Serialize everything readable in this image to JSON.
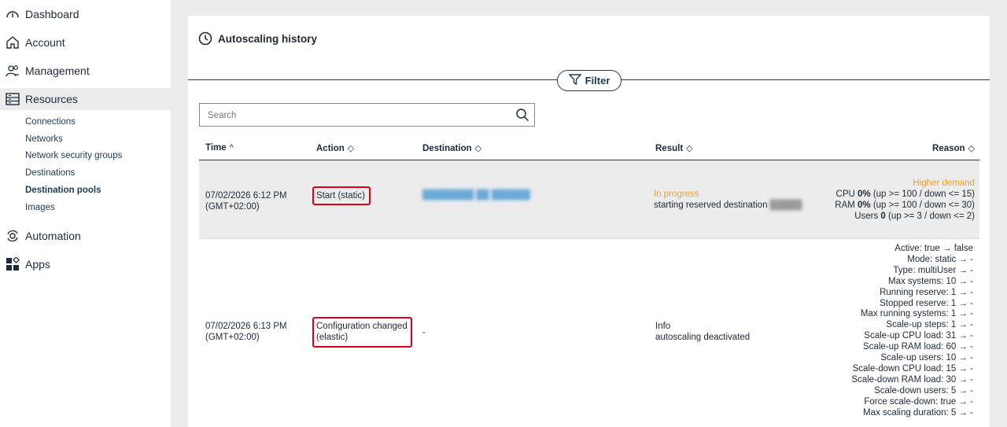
{
  "sidebar": {
    "items": [
      {
        "label": "Dashboard",
        "icon": "gauge-icon"
      },
      {
        "label": "Account",
        "icon": "home-icon"
      },
      {
        "label": "Management",
        "icon": "users-icon"
      },
      {
        "label": "Resources",
        "icon": "server-icon"
      },
      {
        "label": "Automation",
        "icon": "gear-sync-icon"
      },
      {
        "label": "Apps",
        "icon": "apps-icon"
      }
    ],
    "sub_items": [
      "Connections",
      "Networks",
      "Network security groups",
      "Destinations",
      "Destination pools",
      "Images"
    ]
  },
  "panel": {
    "title": "Autoscaling history",
    "filter_label": "Filter",
    "search_placeholder": "Search"
  },
  "table": {
    "columns": [
      "Time",
      "Action",
      "Destination",
      "Result",
      "Reason"
    ],
    "rows": [
      {
        "time_line1": "07/02/2026 6:12 PM",
        "time_line2": "(GMT+02:00)",
        "action": "Start (static)",
        "destination": "",
        "result_status": "In progress",
        "result_detail": "starting reserved destination",
        "reason_title": "Higher demand",
        "reason_cpu_prefix": "CPU ",
        "reason_cpu_value": "0%",
        "reason_cpu_suffix": " (up >= 100 / down <= 15)",
        "reason_ram_prefix": "RAM ",
        "reason_ram_value": "0%",
        "reason_ram_suffix": " (up >= 100 / down <= 30)",
        "reason_users_prefix": "Users ",
        "reason_users_value": "0",
        "reason_users_suffix": " (up >= 3 / down <= 2)"
      },
      {
        "time_line1": "07/02/2026 6:13 PM",
        "time_line2": "(GMT+02:00)",
        "action_line1": "Configuration changed",
        "action_line2": "(elastic)",
        "destination": "-",
        "result_status": "Info",
        "result_detail": "autoscaling deactivated",
        "reason_lines": [
          "Active: true → false",
          "Mode: static → -",
          "Type: multiUser → -",
          "Max systems: 10 → -",
          "Running reserve: 1 → -",
          "Stopped reserve: 1 → -",
          "Max running systems: 1 → -",
          "Scale-up steps: 1 → -",
          "Scale-up CPU load: 31 → -",
          "Scale-up RAM load: 60 → -",
          "Scale-up users: 10 → -",
          "Scale-down CPU load: 15 → -",
          "Scale-down RAM load: 30 → -",
          "Scale-down users: 5 → -",
          "Force scale-down: true → -",
          "Max scaling duration: 5 → -"
        ]
      }
    ]
  },
  "colors": {
    "accent": "#1b3a56",
    "highlight": "#d9001b",
    "status_in_progress": "#f0a030"
  }
}
